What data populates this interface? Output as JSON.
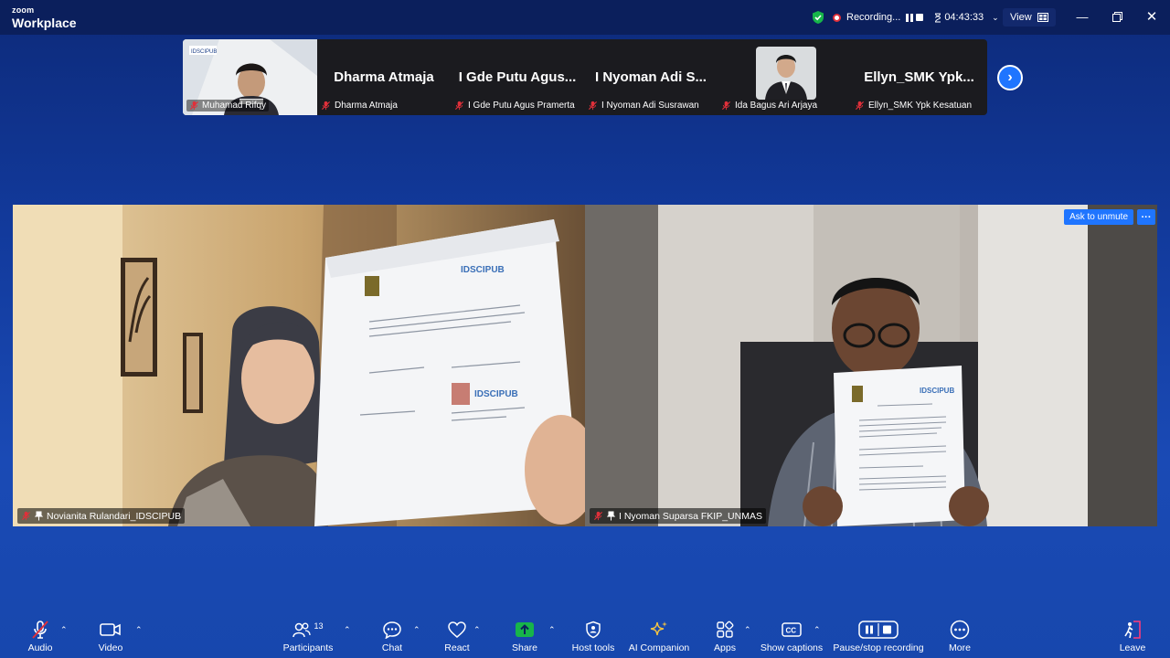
{
  "app": {
    "brand_small": "zoom",
    "brand_big": "Workplace"
  },
  "titlebar": {
    "recording_label": "Recording...",
    "timer": "04:43:33",
    "view_label": "View"
  },
  "thumbnails": [
    {
      "display_name": "",
      "label": "Muhamad Rifqy",
      "type": "video"
    },
    {
      "display_name": "Dharma Atmaja",
      "label": "Dharma Atmaja",
      "type": "name"
    },
    {
      "display_name": "I Gde Putu Agus...",
      "label": "I Gde Putu Agus Pramerta",
      "type": "name"
    },
    {
      "display_name": "I Nyoman Adi S...",
      "label": "I Nyoman Adi Susrawan",
      "type": "name"
    },
    {
      "display_name": "",
      "label": "Ida Bagus Ari Arjaya",
      "type": "photo"
    },
    {
      "display_name": "Ellyn_SMK Ypk...",
      "label": "Ellyn_SMK Ypk Kesatuan",
      "type": "name"
    }
  ],
  "main_videos": [
    {
      "label": "Novianita Rulandari_IDSCIPUB"
    },
    {
      "label": "I Nyoman Suparsa FKIP_UNMAS",
      "ask_unmute": "Ask to unmute",
      "more": "···"
    }
  ],
  "toolbar": {
    "audio": "Audio",
    "video": "Video",
    "participants": "Participants",
    "participants_count": "13",
    "chat": "Chat",
    "react": "React",
    "share": "Share",
    "host_tools": "Host tools",
    "ai_companion": "AI Companion",
    "apps": "Apps",
    "captions": "Show captions",
    "recording": "Pause/stop recording",
    "more": "More",
    "leave": "Leave"
  },
  "colors": {
    "accent": "#1f75ff",
    "share_green": "#17b54a",
    "mute_red": "#e0303a",
    "leave_pink": "#ff3b7a"
  }
}
